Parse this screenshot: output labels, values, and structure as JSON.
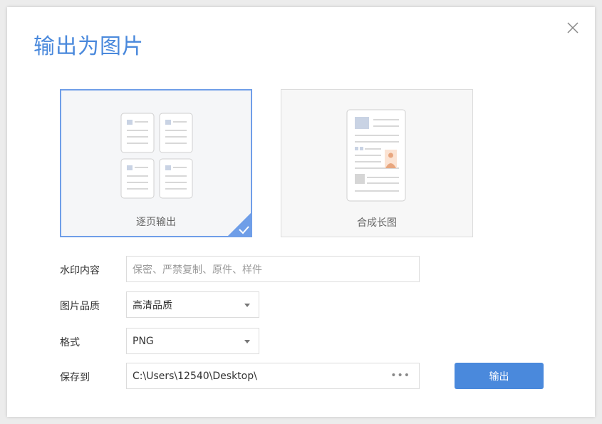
{
  "dialog": {
    "title": "输出为图片"
  },
  "modes": [
    {
      "label": "逐页输出",
      "selected": true
    },
    {
      "label": "合成长图",
      "selected": false
    }
  ],
  "form": {
    "watermark": {
      "label": "水印内容",
      "placeholder": "保密、严禁复制、原件、样件"
    },
    "quality": {
      "label": "图片品质",
      "value": "高清品质"
    },
    "format": {
      "label": "格式",
      "value": "PNG"
    },
    "save_to": {
      "label": "保存到",
      "value": "C:\\Users\\12540\\Desktop\\"
    }
  },
  "export_button": "输出",
  "colors": {
    "accent": "#4a89dc",
    "selected_border": "#6f9ee8"
  },
  "icons": {
    "close": "close-icon",
    "check": "checkmark-icon",
    "more": "more-dots-icon",
    "dropdown": "chevron-down-icon"
  }
}
